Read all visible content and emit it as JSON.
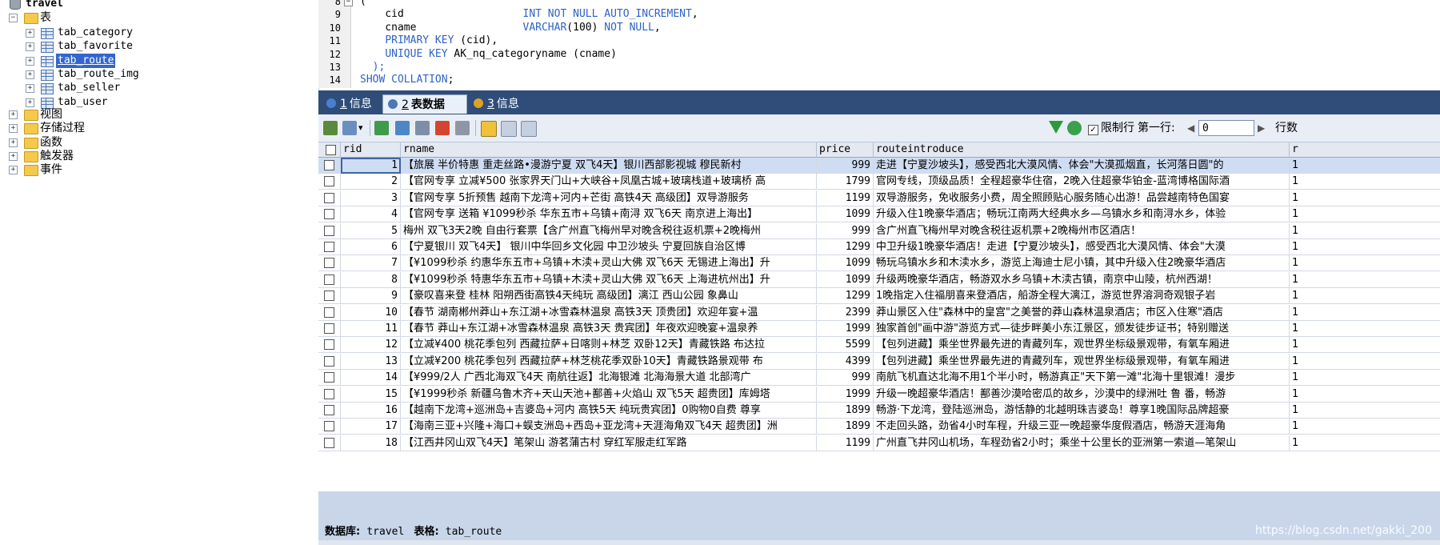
{
  "tree": {
    "database": "travel",
    "tables_folder": "表",
    "tables": [
      "tab_category",
      "tab_favorite",
      "tab_route",
      "tab_route_img",
      "tab_seller",
      "tab_user"
    ],
    "selected_table": "tab_route",
    "other_folders": [
      "视图",
      "存储过程",
      "函数",
      "触发器",
      "事件"
    ],
    "expanded_glyph": "−",
    "collapsed_glyph": "+"
  },
  "editor": {
    "lines": [
      {
        "n": "8",
        "parts": [
          {
            "t": "(",
            "k": "pl"
          }
        ]
      },
      {
        "n": "9",
        "parts": [
          {
            "t": "    cid                   ",
            "k": "pl"
          },
          {
            "t": "INT NOT NULL AUTO_INCREMENT",
            "k": "kw"
          },
          {
            "t": ",",
            "k": "pl"
          }
        ]
      },
      {
        "n": "10",
        "parts": [
          {
            "t": "    cname                 ",
            "k": "pl"
          },
          {
            "t": "VARCHAR",
            "k": "kw"
          },
          {
            "t": "(100) ",
            "k": "pl"
          },
          {
            "t": "NOT NULL",
            "k": "kw"
          },
          {
            "t": ",",
            "k": "pl"
          }
        ]
      },
      {
        "n": "11",
        "parts": [
          {
            "t": "    ",
            "k": "pl"
          },
          {
            "t": "PRIMARY KEY",
            "k": "kw"
          },
          {
            "t": " (cid),",
            "k": "pl"
          }
        ]
      },
      {
        "n": "12",
        "parts": [
          {
            "t": "    ",
            "k": "pl"
          },
          {
            "t": "UNIQUE KEY",
            "k": "kw"
          },
          {
            "t": " AK_nq_categoryname (cname)",
            "k": "pl"
          }
        ]
      },
      {
        "n": "13",
        "parts": [
          {
            "t": "  );",
            "k": "kw"
          }
        ]
      },
      {
        "n": "14",
        "parts": [
          {
            "t": "SHOW COLLATION",
            "k": "kw"
          },
          {
            "t": ";",
            "k": "pl"
          }
        ]
      }
    ],
    "fold_glyph": "−"
  },
  "tabs": [
    {
      "num": "1",
      "label": "信息",
      "active": false,
      "icon_color": "#4a7fd0"
    },
    {
      "num": "2",
      "label": "表数据",
      "active": true,
      "icon_color": "#4e77b5"
    },
    {
      "num": "3",
      "label": "信息",
      "active": false,
      "icon_color": "#e0a020"
    }
  ],
  "toolbar": {
    "limit_label": "限制行",
    "limit_checked": "✓",
    "first_row_label": "第一行:",
    "first_row_value": "0",
    "rows_label": "行数",
    "prev_glyph": "◀",
    "next_glyph": "▶",
    "dropdown_glyph": "▾"
  },
  "grid": {
    "columns": [
      "rid",
      "rname",
      "price",
      "routeintroduce",
      "r"
    ],
    "rows": [
      {
        "rid": "1",
        "rname": "【旅展 半价特惠 重走丝路•漫游宁夏 双飞4天】银川西部影视城 穆民新村",
        "price": "999",
        "intro": "走进【宁夏沙坡头】，感受西北大漠风情、体会\"大漠孤烟直，长河落日圆\"的",
        "r": "1"
      },
      {
        "rid": "2",
        "rname": "【官网专享 立减¥500 张家界天门山+大峡谷+凤凰古城+玻璃栈道+玻璃桥 高",
        "price": "1799",
        "intro": "官网专线，顶级品质！全程超豪华住宿，2晚入住超豪华铂金-蓝湾博格国际酒",
        "r": "1"
      },
      {
        "rid": "3",
        "rname": "【官网专享 5折预售 越南下龙湾+河内+芒街 高铁4天 高级团】双导游服务",
        "price": "1199",
        "intro": "双导游服务，免收服务小费，周全照顾贴心服务随心出游！品尝越南特色国宴",
        "r": "1"
      },
      {
        "rid": "4",
        "rname": "【官网专享 送箱 ¥1099秒杀 华东五市+乌镇+南浔 双飞6天 南京进上海出】",
        "price": "1099",
        "intro": "升级入住1晚豪华酒店；畅玩江南两大经典水乡—乌镇水乡和南浔水乡，体验",
        "r": "1"
      },
      {
        "rid": "5",
        "rname": "梅州 双飞3天2晚 自由行套票【含广州直飞梅州早对晚含税往返机票+2晚梅州",
        "price": "999",
        "intro": "含广州直飞梅州早对晚含税往返机票+2晚梅州市区酒店！",
        "r": "1"
      },
      {
        "rid": "6",
        "rname": "【宁夏银川 双飞4天】 银川中华回乡文化园 中卫沙坡头 宁夏回族自治区博",
        "price": "1299",
        "intro": "中卫升级1晚豪华酒店！走进【宁夏沙坡头】，感受西北大漠风情、体会\"大漠",
        "r": "1"
      },
      {
        "rid": "7",
        "rname": "【¥1099秒杀 约惠华东五市+乌镇+木渎+灵山大佛 双飞6天 无锡进上海出】升",
        "price": "1099",
        "intro": "畅玩乌镇水乡和木渎水乡，游览上海迪士尼小镇，其中升级入住2晚豪华酒店",
        "r": "1"
      },
      {
        "rid": "8",
        "rname": "【¥1099秒杀 特惠华东五市+乌镇+木渎+灵山大佛 双飞6天 上海进杭州出】升",
        "price": "1099",
        "intro": "升级两晚豪华酒店，畅游双水乡乌镇+木渎古镇，南京中山陵，杭州西湖！",
        "r": "1"
      },
      {
        "rid": "9",
        "rname": "【豪叹喜来登 桂林 阳朔西街高铁4天纯玩 高级团】漓江 西山公园 象鼻山",
        "price": "1299",
        "intro": "1晚指定入住福朋喜来登酒店，船游全程大漓江，游览世界溶洞奇观银子岩",
        "r": "1"
      },
      {
        "rid": "10",
        "rname": "【春节 湖南郴州莽山+东江湖+冰雪森林温泉 高铁3天 顶贵团】欢迎年宴+温",
        "price": "2399",
        "intro": "莽山景区入住\"森林中的皇宫\"之美誉的莽山森林温泉酒店；市区入住寒\"酒店",
        "r": "1"
      },
      {
        "rid": "11",
        "rname": "【春节 莽山+东江湖+冰雪森林温泉 高铁3天 贵宾团】年夜欢迎晚宴+温泉养",
        "price": "1999",
        "intro": "独家首创\"画中游\"游览方式—徒步畔美小东江景区，颁发徒步证书；特别赠送",
        "r": "1"
      },
      {
        "rid": "12",
        "rname": "【立减¥400 桃花季包列 西藏拉萨+日喀则+林芝 双卧12天】青藏铁路 布达拉",
        "price": "5599",
        "intro": "【包列进藏】乘坐世界最先进的青藏列车，观世界坐标级景观带，有氧车厢进",
        "r": "1"
      },
      {
        "rid": "13",
        "rname": "【立减¥200 桃花季包列 西藏拉萨+林芝桃花季双卧10天】青藏铁路景观带 布",
        "price": "4399",
        "intro": "【包列进藏】乘坐世界最先进的青藏列车，观世界坐标级景观带，有氧车厢进",
        "r": "1"
      },
      {
        "rid": "14",
        "rname": "【¥999/2人 广西北海双飞4天 南航往返】北海银滩 北海海景大道 北部湾广",
        "price": "999",
        "intro": "南航飞机直达北海不用1个半小时，畅游真正\"天下第一滩\"北海十里银滩！漫步",
        "r": "1"
      },
      {
        "rid": "15",
        "rname": "【¥1999秒杀 新疆乌鲁木齐+天山天池+鄯善+火焰山 双飞5天 超贵团】库姆塔",
        "price": "1999",
        "intro": "升级一晚超豪华酒店！鄯善沙漠哈密瓜的故乡，沙漠中的绿洲吐 鲁 番，畅游",
        "r": "1"
      },
      {
        "rid": "16",
        "rname": "【越南下龙湾+巡洲岛+吉婆岛+河内 高铁5天 纯玩贵宾团】0购物0自费 尊享",
        "price": "1899",
        "intro": "畅游·下龙湾，登陆巡洲岛，游恬静的北越明珠吉婆岛！尊享1晚国际品牌超豪",
        "r": "1"
      },
      {
        "rid": "17",
        "rname": "【海南三亚+兴隆+海口+蜈支洲岛+西岛+亚龙湾+天涯海角双飞4天 超贵团】洲",
        "price": "1899",
        "intro": "不走回头路，劲省4小时车程，升级三亚一晚超豪华度假酒店，畅游天涯海角",
        "r": "1"
      },
      {
        "rid": "18",
        "rname": "【江西井冈山双飞4天】笔架山 游茗蒲古村 穿红军服走红军路",
        "price": "1199",
        "intro": "广州直飞井冈山机场，车程劲省2小时；乘坐十公里长的亚洲第一索道—笔架山",
        "r": "1"
      }
    ],
    "scroll_left_glyph": "<"
  },
  "status": {
    "db_label": "数据库:",
    "db_value": "travel",
    "table_label": "表格:",
    "table_value": "tab_route"
  },
  "watermark": "https://blog.csdn.net/gakki_200",
  "colors": {
    "tab_bar": "#2f4d78",
    "selection": "#3366cc",
    "keyword": "#2f62c6",
    "grid_header": "#e4e9f1"
  }
}
